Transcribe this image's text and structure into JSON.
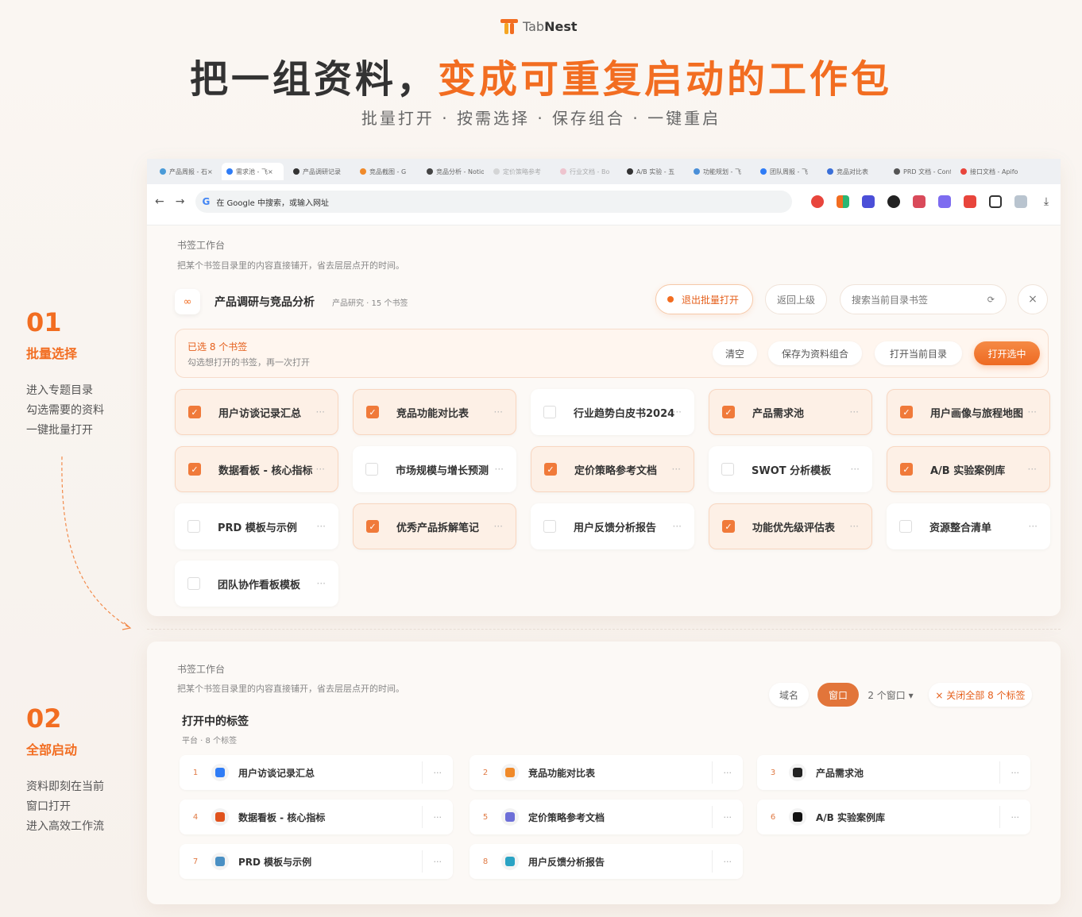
{
  "brand": {
    "name_a": "Tab",
    "name_b": "Nest"
  },
  "headline": {
    "part1": "把一组资料，",
    "part2": "变成可重复启动的工作包"
  },
  "subheadline": "批量打开 · 按需选择 · 保存组合 · 一键重启",
  "steps": [
    {
      "num": "01",
      "title": "批量选择",
      "lines": [
        "进入专题目录",
        "勾选需要的资料",
        "一键批量打开"
      ]
    },
    {
      "num": "02",
      "title": "全部启动",
      "lines": [
        "资料即刻在当前",
        "窗口打开",
        "进入高效工作流"
      ]
    }
  ],
  "browser": {
    "tabs": [
      "产品周报 - 石×",
      "需求池 - 飞×",
      "产品调研记录",
      "竞品截图 - G",
      "竞品分析 - Notion",
      "定价策略参考",
      "行业文档 - Bo",
      "A/B 实验 - 五",
      "功能规划 - 飞",
      "团队周报 - 飞",
      "竞品对比表",
      "PRD 文档 - Confl",
      "接口文档 - Apifox"
    ],
    "omnibox_placeholder": "在 Google 中搜索，或输入网址",
    "colors": {
      "accent": "#f26d21",
      "tab_bg": "#eef0f3"
    }
  },
  "workbench1": {
    "title": "书签工作台",
    "desc": "把某个书签目录里的内容直接铺开，省去层层点开的时间。",
    "folder_name": "产品调研与竞品分析",
    "folder_meta": "产品研究 · 15 个书签",
    "exit_batch": "退出批量打开",
    "back": "返回上级",
    "search_placeholder": "搜索当前目录书签",
    "close": "×",
    "selected_title": "已选 8 个书签",
    "selected_sub": "勾选想打开的书签，再一次打开",
    "btn_clear": "清空",
    "btn_save": "保存为资料组合",
    "btn_open_dir": "打开当前目录",
    "btn_open_sel": "打开选中",
    "bookmarks": [
      {
        "label": "用户访谈记录汇总",
        "checked": true
      },
      {
        "label": "竞品功能对比表",
        "checked": true
      },
      {
        "label": "行业趋势白皮书2024",
        "checked": false
      },
      {
        "label": "产品需求池",
        "checked": true
      },
      {
        "label": "用户画像与旅程地图",
        "checked": true
      },
      {
        "label": "数据看板 - 核心指标",
        "checked": true
      },
      {
        "label": "市场规模与增长预测",
        "checked": false
      },
      {
        "label": "定价策略参考文档",
        "checked": true
      },
      {
        "label": "SWOT 分析模板",
        "checked": false
      },
      {
        "label": "A/B 实验案例库",
        "checked": true
      },
      {
        "label": "PRD 模板与示例",
        "checked": false
      },
      {
        "label": "优秀产品拆解笔记",
        "checked": true
      },
      {
        "label": "用户反馈分析报告",
        "checked": false
      },
      {
        "label": "功能优先级评估表",
        "checked": true
      },
      {
        "label": "资源整合清单",
        "checked": false
      },
      {
        "label": "团队协作看板模板",
        "checked": false
      }
    ]
  },
  "workbench2": {
    "title": "书签工作台",
    "desc": "把某个书签目录里的内容直接铺开，省去层层点开的时间。",
    "btn_domain": "域名",
    "btn_window": "窗口",
    "window_count": "2 个窗口 ▾",
    "close_all": "× 关闭全部 8 个标签",
    "open_title": "打开中的标签",
    "open_meta": "平台 · 8 个标签",
    "tabs": [
      {
        "num": "1",
        "label": "用户访谈记录汇总",
        "color": "#2f7cf6"
      },
      {
        "num": "2",
        "label": "竞品功能对比表",
        "color": "#f08a2a"
      },
      {
        "num": "3",
        "label": "产品需求池",
        "color": "#222222"
      },
      {
        "num": "4",
        "label": "数据看板 - 核心指标",
        "color": "#e0531e"
      },
      {
        "num": "5",
        "label": "定价策略参考文档",
        "color": "#6d6fd8"
      },
      {
        "num": "6",
        "label": "A/B 实验案例库",
        "color": "#111111"
      },
      {
        "num": "7",
        "label": "PRD 模板与示例",
        "color": "#4a90c4"
      },
      {
        "num": "8",
        "label": "用户反馈分析报告",
        "color": "#2aa3c4"
      }
    ]
  }
}
